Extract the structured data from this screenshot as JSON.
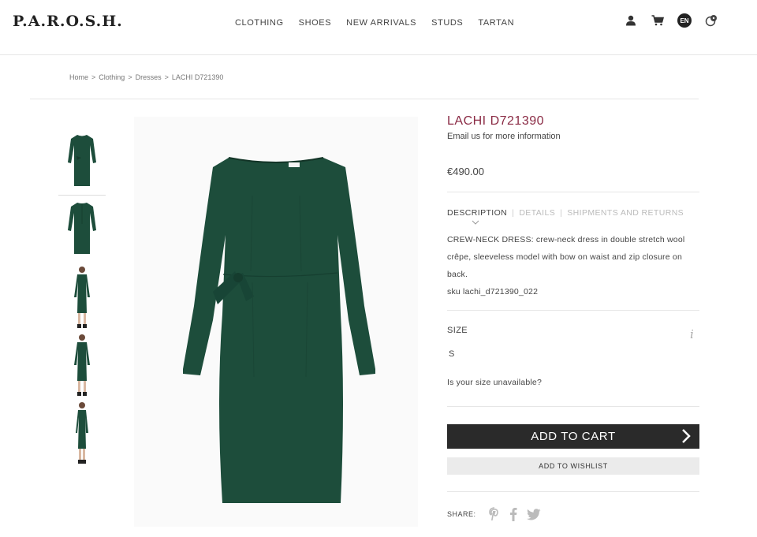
{
  "header": {
    "logo": "P.A.R.O.S.H.",
    "nav": [
      "CLOTHING",
      "SHOES",
      "NEW ARRIVALS",
      "STUDS",
      "TARTAN"
    ],
    "icons": [
      "user-icon",
      "cart-icon",
      "language-icon",
      "chat-icon"
    ],
    "language": "EN"
  },
  "breadcrumb": {
    "items": [
      "Home",
      "Clothing",
      "Dresses",
      "LACHI D721390"
    ],
    "separator": ">"
  },
  "gallery": {
    "thumbnail_count": 5,
    "dress_color": "#1d4d3b"
  },
  "product": {
    "title": "LACHI D721390",
    "email_info": "Email us for more information",
    "price": "€490.00",
    "tabs": [
      "DESCRIPTION",
      "DETAILS",
      "SHIPMENTS AND RETURNS"
    ],
    "description": "CREW-NECK DRESS: crew-neck dress in double stretch wool crêpe, sleeveless model with bow on waist and zip closure on back.",
    "sku": "sku lachi_d721390_022",
    "size_label": "SIZE",
    "size_value": "S",
    "size_unavailable": "Is your size unavailable?",
    "add_to_cart": "ADD TO CART",
    "add_to_wishlist": "ADD TO WISHLIST",
    "share_label": "SHARE:",
    "share_icons": [
      "pinterest-icon",
      "facebook-icon",
      "twitter-icon"
    ]
  },
  "colors": {
    "title_accent": "#8a2a44",
    "cart_button": "#2a2a2a",
    "wishlist_button": "#ebebeb"
  }
}
